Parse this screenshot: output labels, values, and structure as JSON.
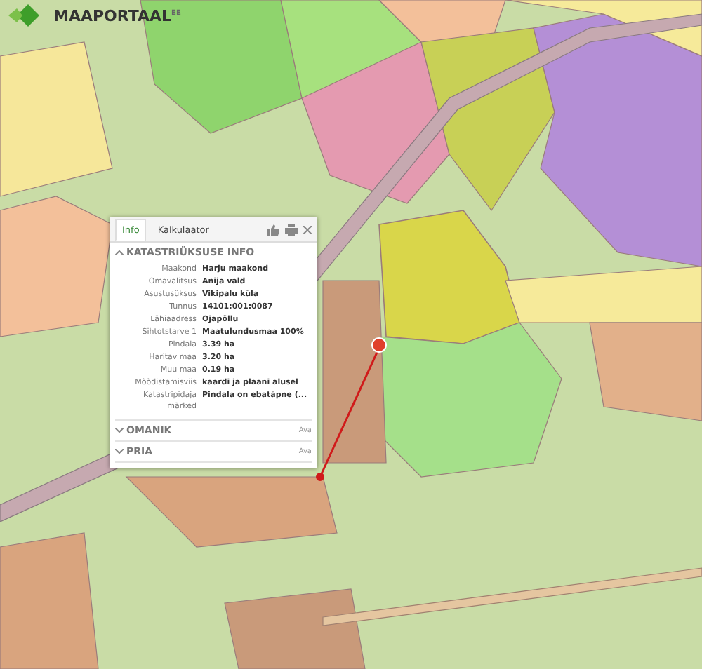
{
  "logo": {
    "text": "MAAPORTAAL",
    "superscript": "EE"
  },
  "popup": {
    "tabs": [
      {
        "label": "Info",
        "selected": true
      },
      {
        "label": "Kalkulaator",
        "selected": false
      }
    ],
    "sections": [
      {
        "title": "KATASTRIÜKSUSE INFO",
        "expanded": true,
        "rows": [
          {
            "label": "Maakond",
            "value": "Harju maakond"
          },
          {
            "label": "Omavalitsus",
            "value": "Anija vald"
          },
          {
            "label": "Asustusüksus",
            "value": "Vikipalu küla"
          },
          {
            "label": "Tunnus",
            "value": "14101:001:0087"
          },
          {
            "label": "Lähiaadress",
            "value": "Ojapõllu"
          },
          {
            "label": "Sihtotstarve 1",
            "value": "Maatulundusmaa 100%"
          },
          {
            "label": "Pindala",
            "value": "3.39 ha"
          },
          {
            "label": "Haritav maa",
            "value": "3.20 ha"
          },
          {
            "label": "Muu maa",
            "value": "0.19 ha"
          },
          {
            "label": "Mõõdistamisviis",
            "value": "kaardi ja plaani alusel"
          },
          {
            "label": "Katastripidaja märked",
            "value": "Pindala on ebatäpne (..."
          }
        ]
      },
      {
        "title": "OMANIK",
        "expanded": false,
        "action": "Ava"
      },
      {
        "title": "PRIA",
        "expanded": false,
        "action": "Ava"
      }
    ]
  }
}
